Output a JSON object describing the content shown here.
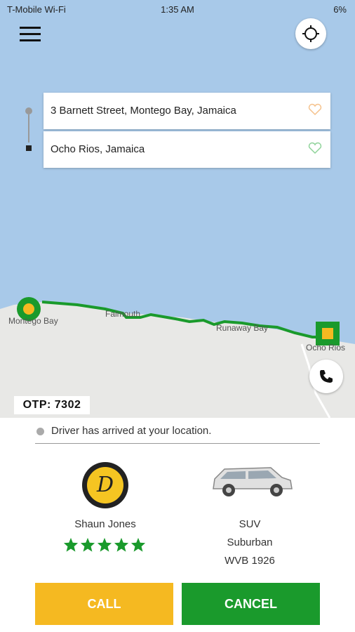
{
  "status_bar": {
    "carrier": "T-Mobile Wi-Fi",
    "time": "1:35 AM",
    "battery": "6%"
  },
  "route": {
    "origin": "3 Barnett Street, Montego Bay, Jamaica",
    "destination": "Ocho Rios, Jamaica"
  },
  "map": {
    "labels": {
      "montego_bay": "Montego Bay",
      "falmouth": "Falmouth",
      "runaway_bay": "Runaway Bay",
      "ocho_rios": "Ocho Rios"
    },
    "route_color": "#1a9a2c",
    "water_color": "#a8c9e9"
  },
  "otp": "OTP: 7302",
  "ride_status": "Driver has arrived at your location.",
  "driver": {
    "name": "Shaun Jones",
    "initial": "D",
    "rating": 5
  },
  "vehicle": {
    "type": "SUV",
    "model": "Suburban",
    "plate": "WVB 1926"
  },
  "actions": {
    "call": "CALL",
    "cancel": "CANCEL"
  },
  "colors": {
    "accent_yellow": "#f5b921",
    "accent_green": "#1a9a2c"
  },
  "icons": {
    "menu": "hamburger-icon",
    "locate": "crosshair-icon",
    "favorite": "heart-icon",
    "phone": "phone-icon",
    "star": "star-icon"
  }
}
